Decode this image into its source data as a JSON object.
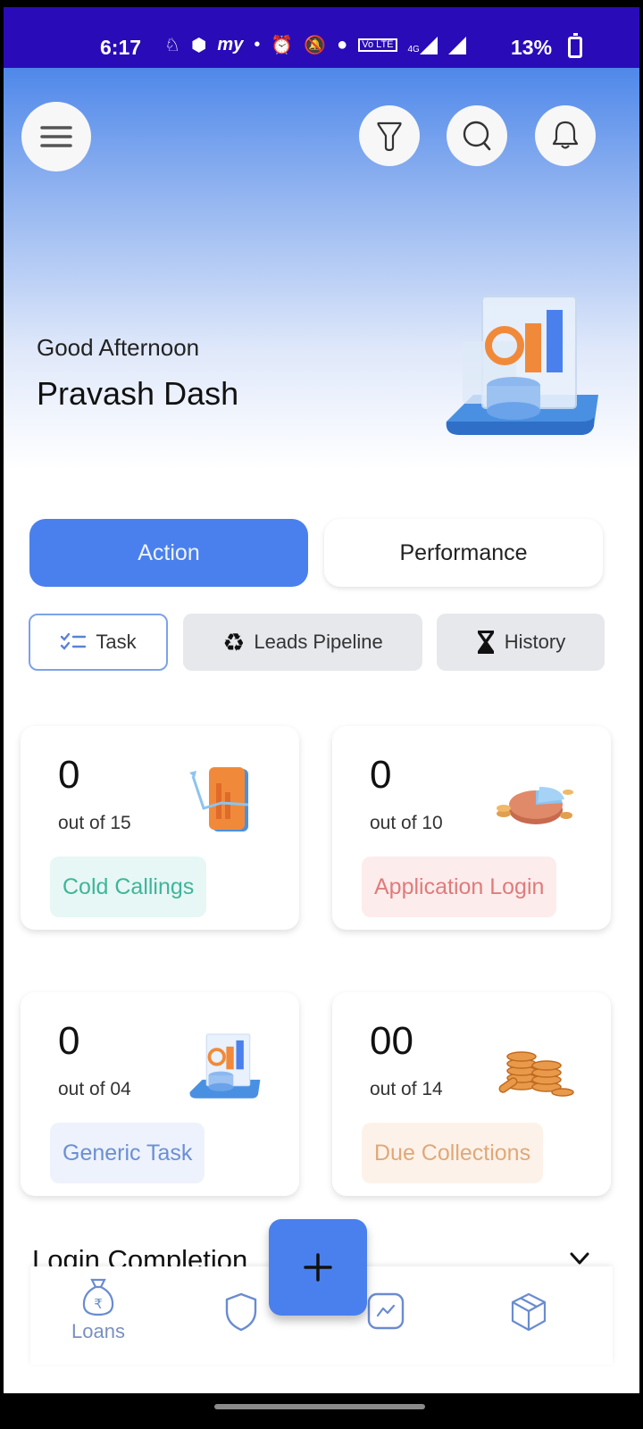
{
  "status_bar": {
    "time": "6:17",
    "battery_percent": "13%",
    "network": "4G",
    "icons": [
      "scooter-icon",
      "app-icon",
      "myapp-icon",
      "dot-icon",
      "alarm-icon",
      "bell-muted-icon",
      "location-icon",
      "volte-icon",
      "signal-4g-icon",
      "signal-icon",
      "battery-icon"
    ]
  },
  "header": {
    "menu_icon": "hamburger-menu-icon",
    "actions": [
      {
        "name": "filter",
        "icon": "filter-icon"
      },
      {
        "name": "search",
        "icon": "search-icon"
      },
      {
        "name": "notifications",
        "icon": "bell-icon"
      }
    ]
  },
  "greeting": {
    "salutation": "Good Afternoon",
    "name": "Pravash Dash"
  },
  "segments": {
    "active": "Action",
    "items": [
      {
        "label": "Action",
        "active": true
      },
      {
        "label": "Performance",
        "active": false
      }
    ]
  },
  "chips": {
    "items": [
      {
        "label": "Task",
        "icon": "checklist-icon",
        "active": true
      },
      {
        "label": "Leads Pipeline",
        "icon": "recycle-icon",
        "active": false
      },
      {
        "label": "History",
        "icon": "hourglass-icon",
        "active": false
      }
    ]
  },
  "cards": [
    {
      "count": "0",
      "subtitle": "out of 15",
      "tag": "Cold Callings",
      "tag_color": "#3fb59a",
      "tag_bg": "#e6f7f5",
      "illustration": "phone-chart-illustration"
    },
    {
      "count": "0",
      "subtitle": "out of 10",
      "tag": "Application Login",
      "tag_color": "#e07b7b",
      "tag_bg": "#fdecec",
      "illustration": "pie-coins-illustration"
    },
    {
      "count": "0",
      "subtitle": "out of 04",
      "tag": "Generic Task",
      "tag_color": "#6b8fd4",
      "tag_bg": "#edf2fc",
      "illustration": "dashboard-illustration"
    },
    {
      "count": "00",
      "subtitle": "out of 14",
      "tag": "Due Collections",
      "tag_color": "#e0a878",
      "tag_bg": "#fdf2e9",
      "illustration": "coins-stack-illustration"
    }
  ],
  "login_completion": {
    "title": "Login Completion"
  },
  "fab": {
    "icon": "plus-icon"
  },
  "bottom_nav": {
    "items": [
      {
        "label": "Loans",
        "icon": "money-bag-rupee-icon",
        "active": true
      },
      {
        "label": "",
        "icon": "shield-icon"
      },
      {
        "label": "",
        "icon": "chart-icon"
      },
      {
        "label": "",
        "icon": "box-icon"
      }
    ]
  },
  "colors": {
    "accent": "#4a80ed",
    "status_bar": "#2a0bb8",
    "chip_bg": "#e6e8ec"
  }
}
